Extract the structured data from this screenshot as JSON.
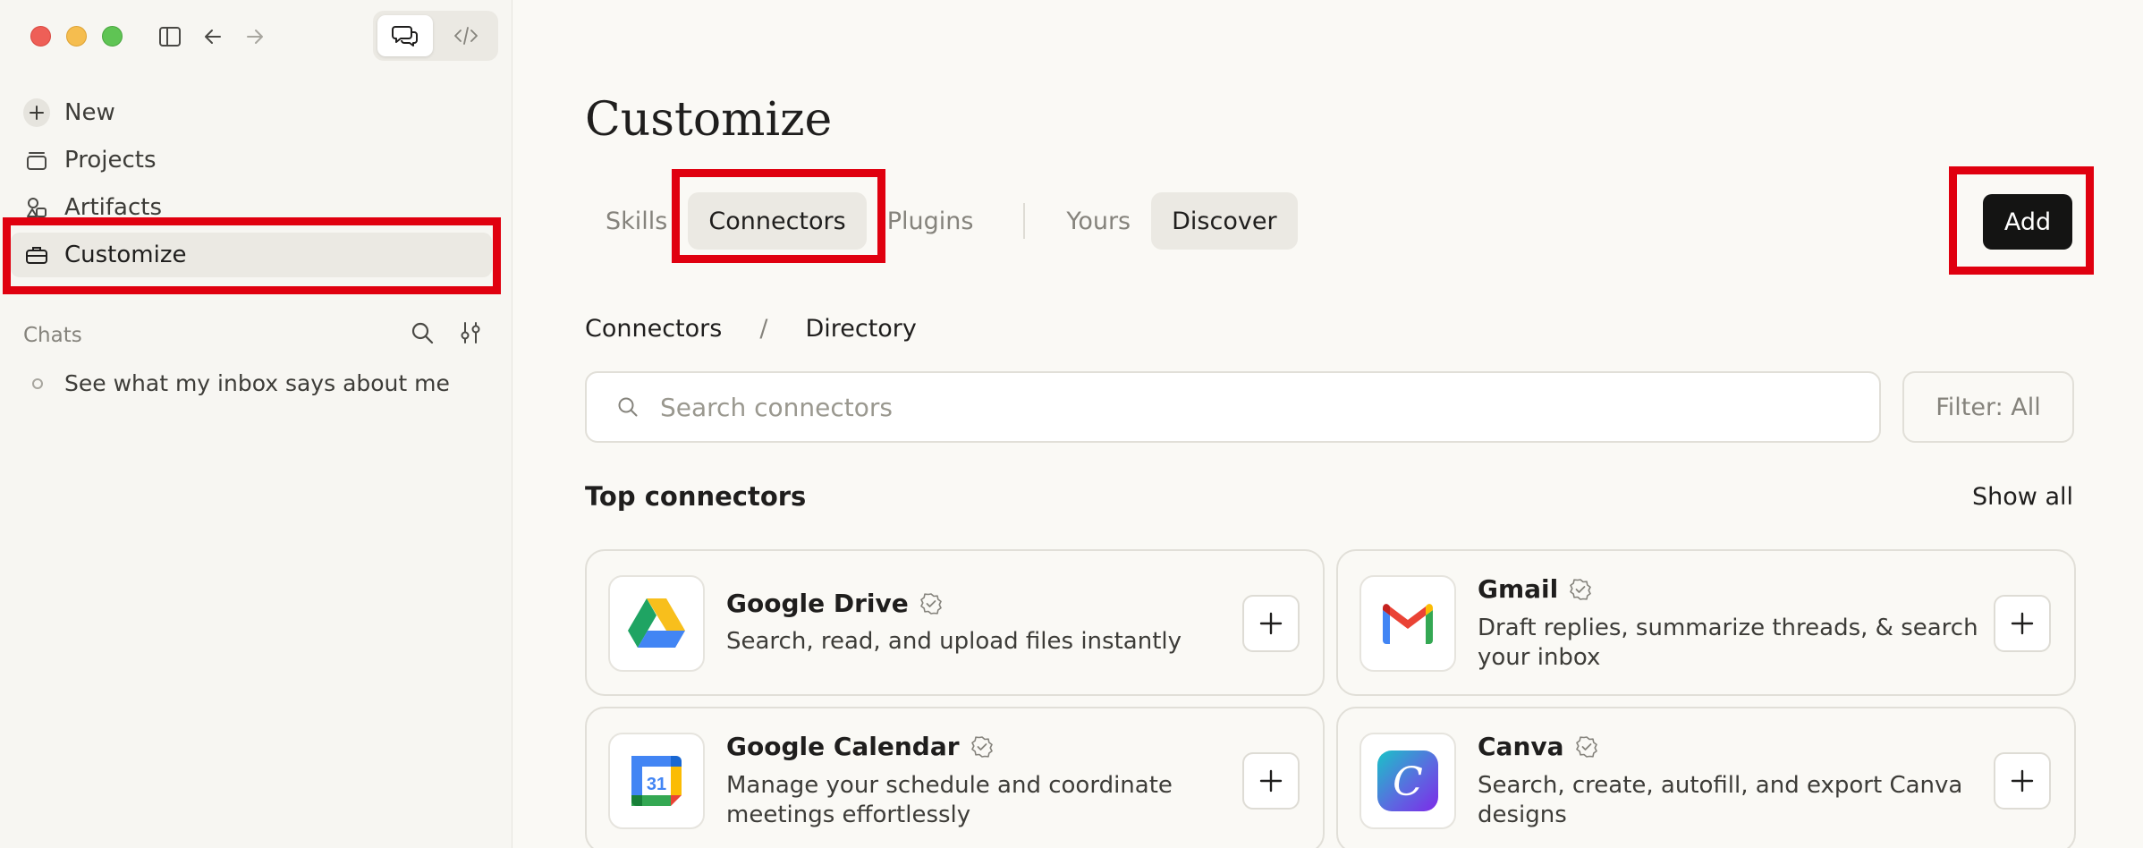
{
  "sidebar": {
    "nav": [
      {
        "label": "New",
        "icon": "plus-icon"
      },
      {
        "label": "Projects",
        "icon": "projects-icon"
      },
      {
        "label": "Artifacts",
        "icon": "artifacts-icon"
      },
      {
        "label": "Customize",
        "icon": "briefcase-icon"
      }
    ],
    "selected": "Customize",
    "chats_label": "Chats",
    "chats": [
      "See what my inbox says about me"
    ]
  },
  "main": {
    "title": "Customize",
    "tabs": [
      "Skills",
      "Connectors",
      "Plugins"
    ],
    "active_tab": "Connectors",
    "view_tabs": [
      "Yours",
      "Discover"
    ],
    "active_view": "Discover",
    "add_label": "Add",
    "breadcrumb": {
      "parent": "Connectors",
      "separator": "/",
      "current": "Directory"
    },
    "search_placeholder": "Search connectors",
    "filter_label": "Filter: All",
    "section_title": "Top connectors",
    "show_all": "Show all",
    "connectors": [
      {
        "name": "Google Drive",
        "description": "Search, read, and upload files instantly",
        "icon": "google-drive-icon"
      },
      {
        "name": "Gmail",
        "description": "Draft replies, summarize threads, & search your inbox",
        "icon": "gmail-icon"
      },
      {
        "name": "Google Calendar",
        "description": "Manage your schedule and coordinate meetings effortlessly",
        "icon": "google-calendar-icon",
        "icon_text": "31"
      },
      {
        "name": "Canva",
        "description": "Search, create, autofill, and export Canva designs",
        "icon": "canva-icon",
        "icon_text": "C"
      }
    ]
  },
  "highlights": [
    "customize-nav",
    "connectors-tab",
    "add-button"
  ],
  "colors": {
    "highlight": "#e0000f",
    "accent_dark": "#141413",
    "background": "#faf9f5"
  }
}
